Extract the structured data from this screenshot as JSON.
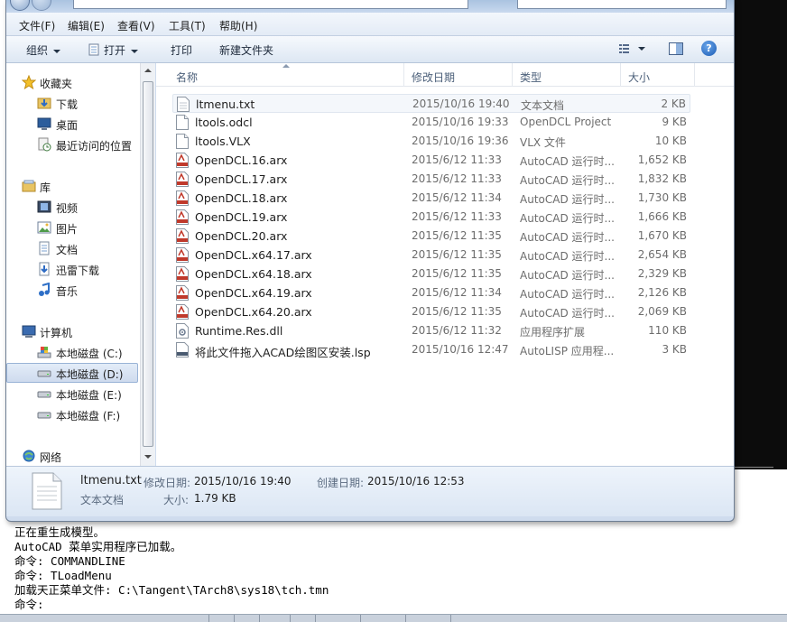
{
  "menu": [
    "文件(F)",
    "编辑(E)",
    "查看(V)",
    "工具(T)",
    "帮助(H)"
  ],
  "toolbar": {
    "organize": "组织",
    "open": "打开",
    "print": "打印",
    "new_folder": "新建文件夹",
    "help": "?"
  },
  "nav": {
    "favorites_header": "收藏夹",
    "favorites": [
      "下载",
      "桌面",
      "最近访问的位置"
    ],
    "libraries_header": "库",
    "libraries": [
      "视频",
      "图片",
      "文档",
      "迅雷下载",
      "音乐"
    ],
    "computer_header": "计算机",
    "drives": [
      "本地磁盘 (C:)",
      "本地磁盘 (D:)",
      "本地磁盘 (E:)",
      "本地磁盘 (F:)"
    ],
    "network_header": "网络"
  },
  "columns": {
    "name": "名称",
    "date": "修改日期",
    "type": "类型",
    "size": "大小"
  },
  "files": [
    {
      "name": "ltmenu.txt",
      "date": "2015/10/16 19:40",
      "type": "文本文档",
      "size": "2 KB",
      "icon": "text-file-icon"
    },
    {
      "name": "ltools.odcl",
      "date": "2015/10/16 19:33",
      "type": "OpenDCL Project",
      "size": "9 KB",
      "icon": "blank-file-icon"
    },
    {
      "name": "ltools.VLX",
      "date": "2015/10/16 19:36",
      "type": "VLX 文件",
      "size": "10 KB",
      "icon": "blank-file-icon"
    },
    {
      "name": "OpenDCL.16.arx",
      "date": "2015/6/12 11:33",
      "type": "AutoCAD 运行时...",
      "size": "1,652 KB",
      "icon": "arx-file-icon"
    },
    {
      "name": "OpenDCL.17.arx",
      "date": "2015/6/12 11:33",
      "type": "AutoCAD 运行时...",
      "size": "1,832 KB",
      "icon": "arx-file-icon"
    },
    {
      "name": "OpenDCL.18.arx",
      "date": "2015/6/12 11:34",
      "type": "AutoCAD 运行时...",
      "size": "1,730 KB",
      "icon": "arx-file-icon"
    },
    {
      "name": "OpenDCL.19.arx",
      "date": "2015/6/12 11:33",
      "type": "AutoCAD 运行时...",
      "size": "1,666 KB",
      "icon": "arx-file-icon"
    },
    {
      "name": "OpenDCL.20.arx",
      "date": "2015/6/12 11:35",
      "type": "AutoCAD 运行时...",
      "size": "1,670 KB",
      "icon": "arx-file-icon"
    },
    {
      "name": "OpenDCL.x64.17.arx",
      "date": "2015/6/12 11:35",
      "type": "AutoCAD 运行时...",
      "size": "2,654 KB",
      "icon": "arx-file-icon"
    },
    {
      "name": "OpenDCL.x64.18.arx",
      "date": "2015/6/12 11:35",
      "type": "AutoCAD 运行时...",
      "size": "2,329 KB",
      "icon": "arx-file-icon"
    },
    {
      "name": "OpenDCL.x64.19.arx",
      "date": "2015/6/12 11:34",
      "type": "AutoCAD 运行时...",
      "size": "2,126 KB",
      "icon": "arx-file-icon"
    },
    {
      "name": "OpenDCL.x64.20.arx",
      "date": "2015/6/12 11:35",
      "type": "AutoCAD 运行时...",
      "size": "2,069 KB",
      "icon": "arx-file-icon"
    },
    {
      "name": "Runtime.Res.dll",
      "date": "2015/6/12 11:32",
      "type": "应用程序扩展",
      "size": "110 KB",
      "icon": "dll-file-icon"
    },
    {
      "name": "将此文件拖入ACAD绘图区安装.lsp",
      "date": "2015/10/16 12:47",
      "type": "AutoLISP 应用程...",
      "size": "3 KB",
      "icon": "lsp-file-icon"
    }
  ],
  "details": {
    "name": "ltmenu.txt",
    "type": "文本文档",
    "modified_label": "修改日期:",
    "modified": "2015/10/16 19:40",
    "created_label": "创建日期:",
    "created": "2015/10/16 12:53",
    "size_label": "大小:",
    "size": "1.79 KB"
  },
  "command_lines": [
    "正在重生成模型。",
    "AutoCAD 菜单实用程序已加载。",
    "命令: COMMANDLINE",
    "命令: TLoadMenu",
    "加载天正菜单文件: C:\\Tangent\\TArch8\\sys18\\tch.tmn",
    "命令:"
  ]
}
